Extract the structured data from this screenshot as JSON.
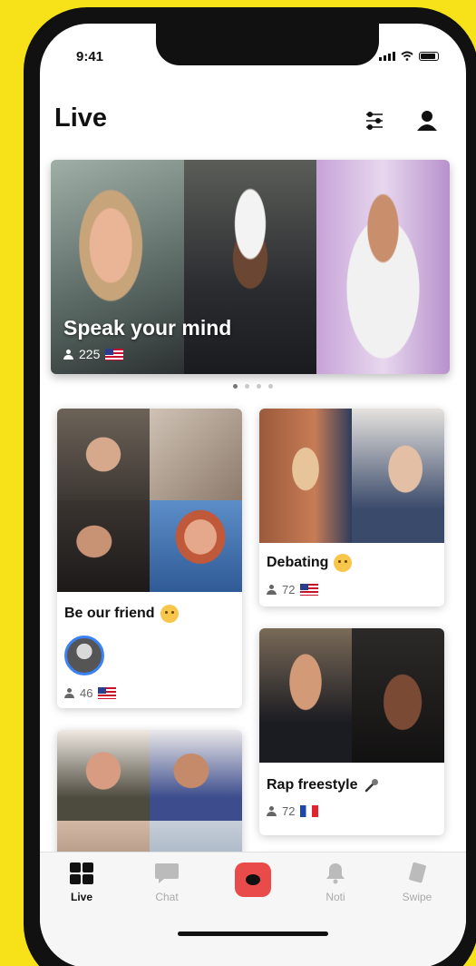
{
  "status": {
    "time": "9:41"
  },
  "header": {
    "title": "Live",
    "filter_icon": "sliders-icon",
    "profile_icon": "person-icon"
  },
  "hero": {
    "title": "Speak your mind",
    "viewers": "225",
    "flag": "us-flag-icon"
  },
  "carousel": {
    "pages": 4,
    "active_index": 0
  },
  "cards": [
    {
      "title": "Be our friend",
      "viewers": "46",
      "emoji": "smiling-halo-emoji",
      "flag": "us-flag-icon"
    },
    {
      "title": "Debating",
      "viewers": "72",
      "emoji": "smiling-emoji",
      "flag": "us-flag-icon"
    },
    {
      "title": "Rap freestyle",
      "viewers": "72",
      "emoji": "microphone-emoji",
      "flag": "fr-flag-icon"
    }
  ],
  "tabs": [
    {
      "label": "Live",
      "icon": "grid-icon",
      "active": true
    },
    {
      "label": "Chat",
      "icon": "chat-bubble-icon",
      "active": false
    },
    {
      "label": "",
      "icon": "camera-record-icon",
      "active": false
    },
    {
      "label": "Noti",
      "icon": "bell-icon",
      "active": false
    },
    {
      "label": "Swipe",
      "icon": "cards-icon",
      "active": false
    }
  ],
  "colors": {
    "accent": "#e94b4b",
    "background": "#f7e21a"
  }
}
